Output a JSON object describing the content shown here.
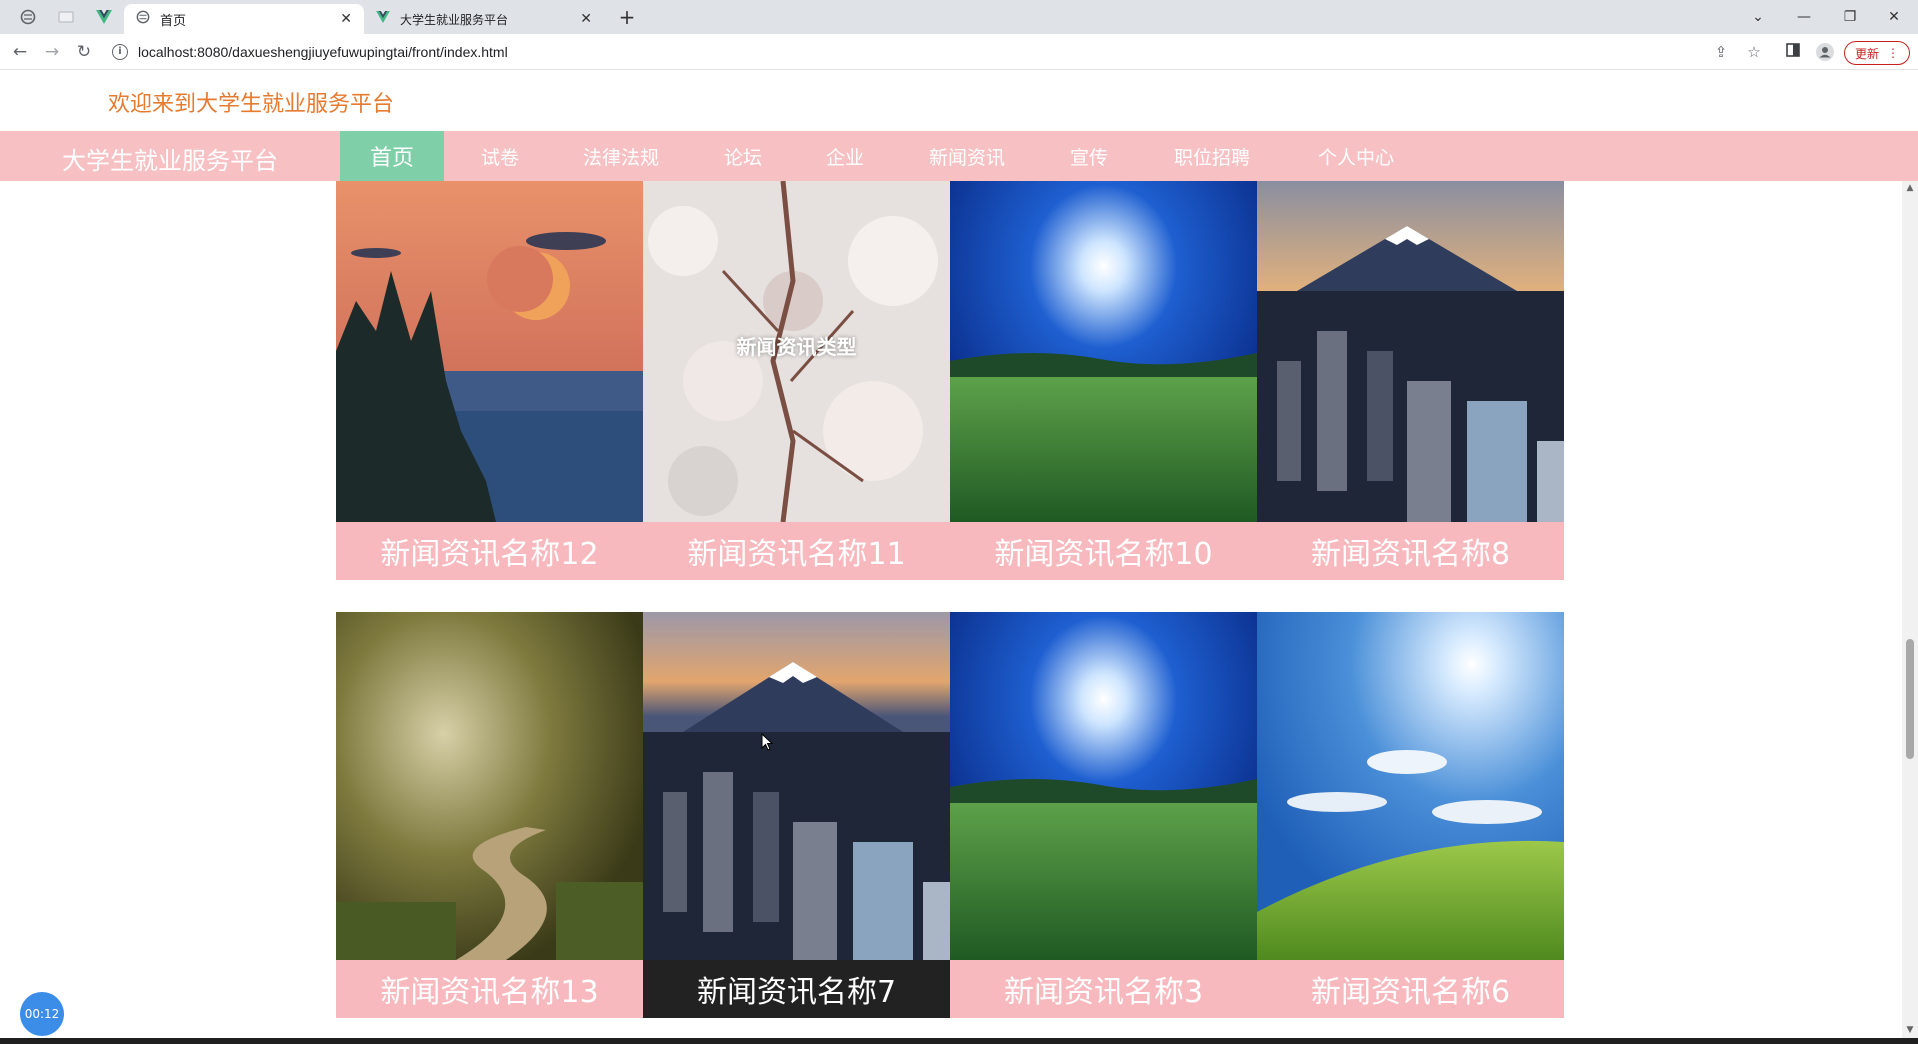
{
  "browser": {
    "tabs": [
      {
        "title": "首页",
        "active": true
      },
      {
        "title": "大学生就业服务平台",
        "active": false
      }
    ],
    "url": "localhost:8080/daxueshengjiuyefuwupingtai/front/index.html",
    "update_label": "更新"
  },
  "page": {
    "welcome": "欢迎来到大学生就业服务平台",
    "brand": "大学生就业服务平台",
    "nav": [
      {
        "label": "首页",
        "active": true
      },
      {
        "label": "试卷"
      },
      {
        "label": "法律法规"
      },
      {
        "label": "论坛"
      },
      {
        "label": "企业"
      },
      {
        "label": "新闻资讯"
      },
      {
        "label": "宣传"
      },
      {
        "label": "职位招聘"
      },
      {
        "label": "个人中心"
      }
    ],
    "news_rows": [
      [
        {
          "title": "新闻资讯名称12",
          "image": "lake-moon-sunset"
        },
        {
          "title": "新闻资讯名称11",
          "image": "cherry-blossom",
          "overlay": "新闻资讯类型"
        },
        {
          "title": "新闻资讯名称10",
          "image": "sun-over-meadow"
        },
        {
          "title": "新闻资讯名称8",
          "image": "mount-fuji-city"
        }
      ],
      [
        {
          "title": "新闻资讯名称13",
          "image": "forest-path"
        },
        {
          "title": "新闻资讯名称7",
          "image": "mount-fuji-city",
          "hovered": true
        },
        {
          "title": "新闻资讯名称3",
          "image": "sun-over-meadow"
        },
        {
          "title": "新闻资讯名称6",
          "image": "sky-green-hill"
        }
      ]
    ]
  },
  "overlay": {
    "timer": "00:12"
  },
  "colors": {
    "nav_bg": "#f7c1c4",
    "nav_active": "#7fd0a8",
    "welcome_text": "#e67a2e",
    "caption_bg": "#f7b9bd",
    "caption_hover_bg": "#222222"
  }
}
